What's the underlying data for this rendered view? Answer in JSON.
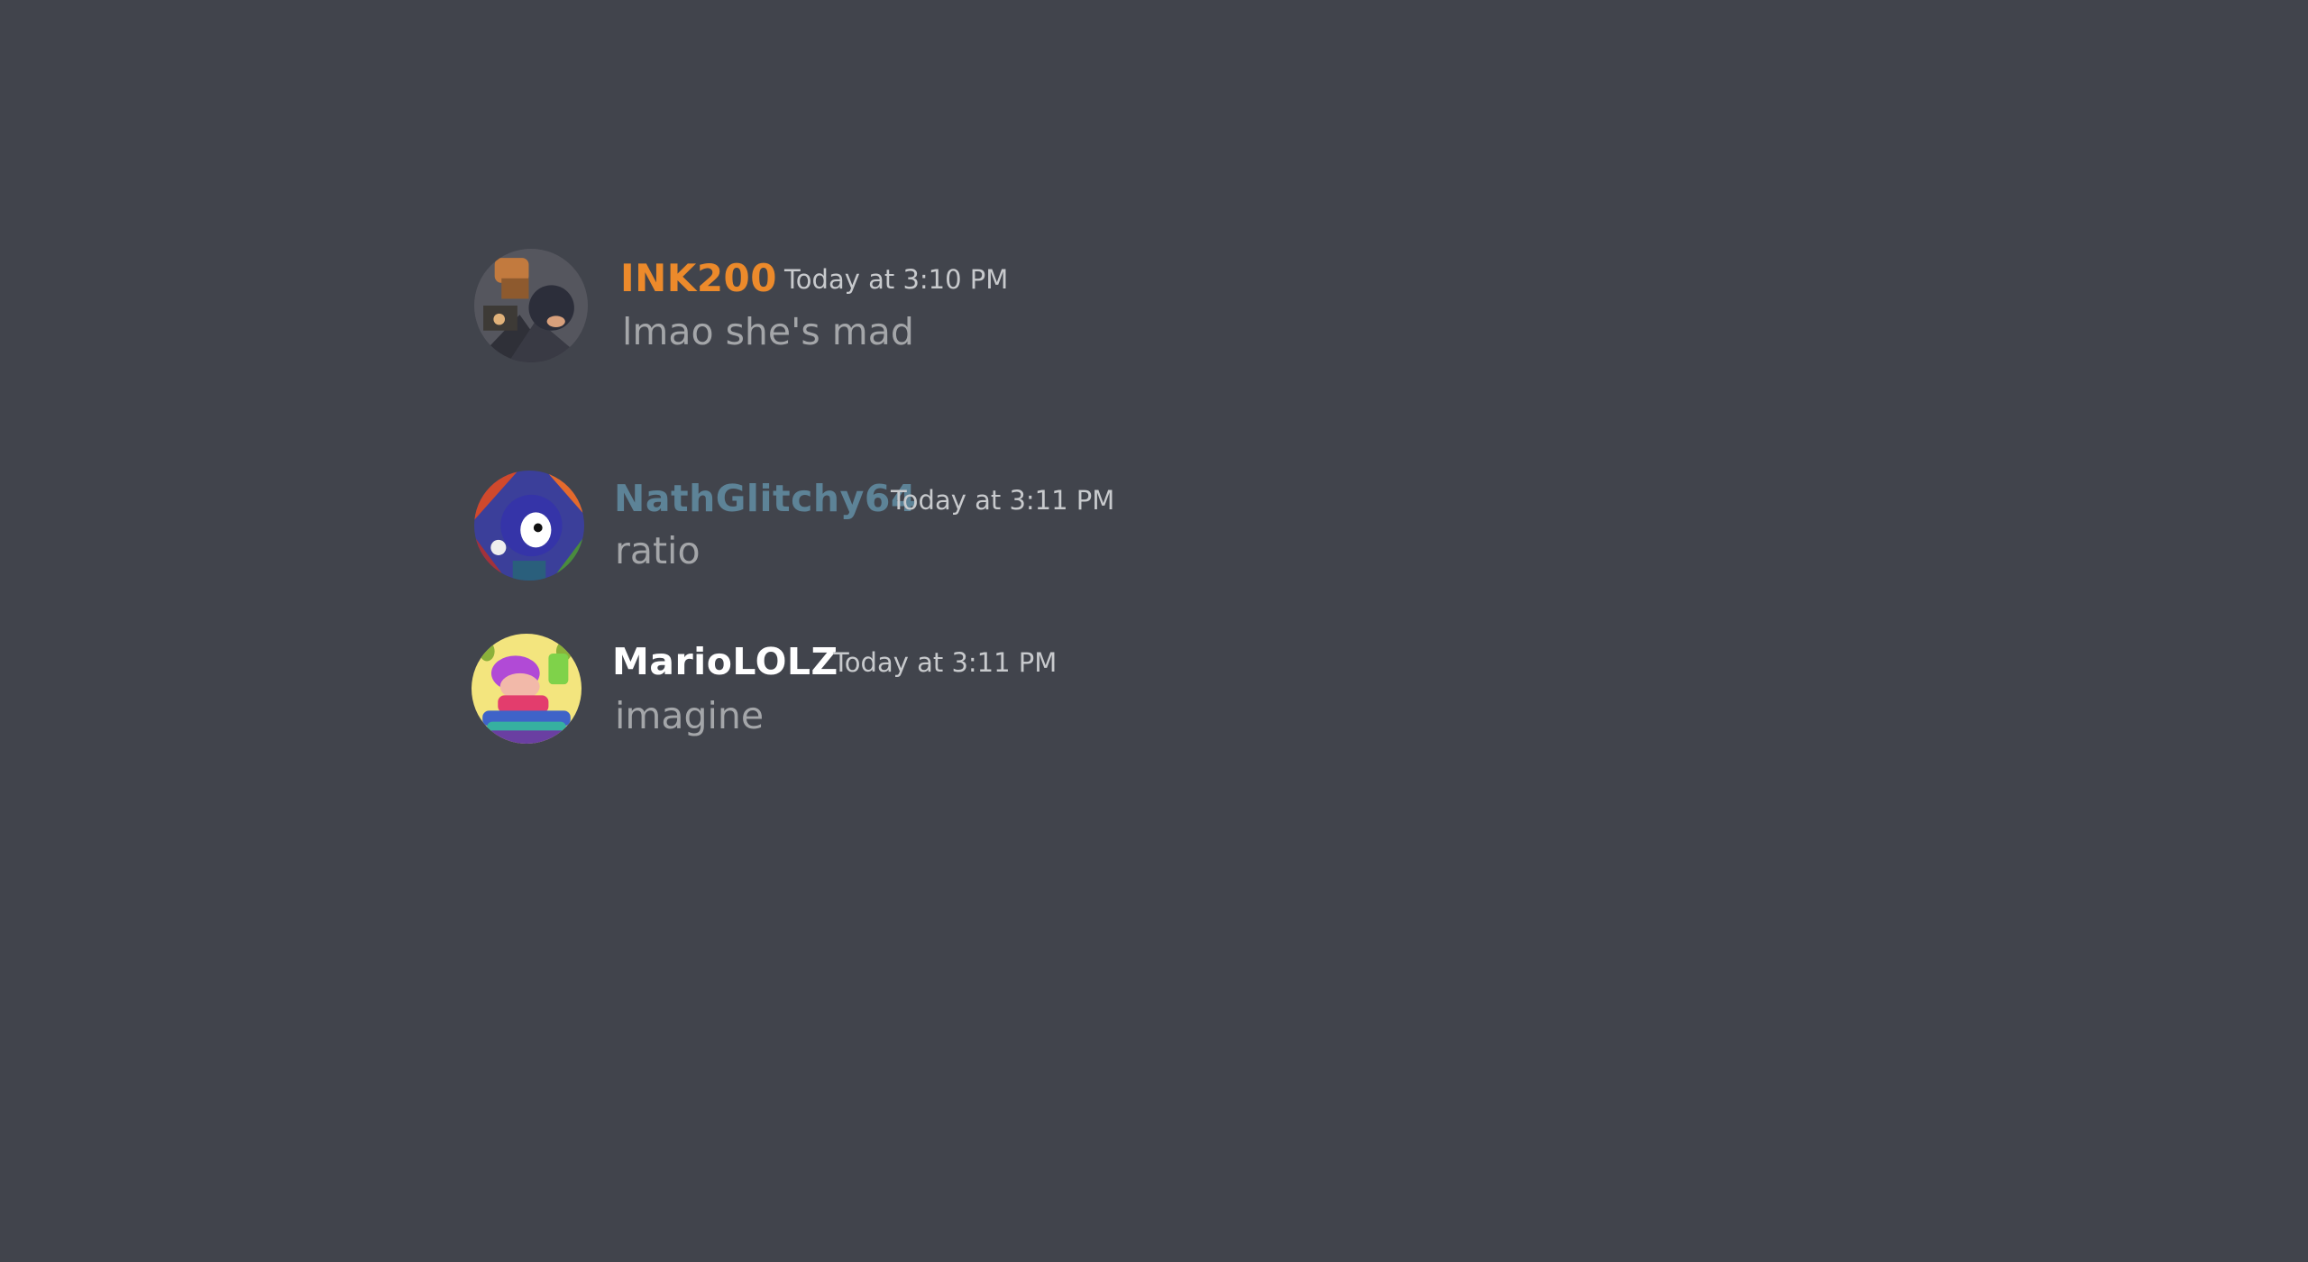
{
  "colors": {
    "background": "#41444c",
    "timestamp": "#c8cacd",
    "message_text": "#a4a6a9"
  },
  "messages": [
    {
      "username": "INK200",
      "username_color": "#ec8a2b",
      "timestamp": "Today at 3:10 PM",
      "text": "lmao she's mad",
      "avatar_icon": "ink200-avatar-icon"
    },
    {
      "username": "NathGlitchy64",
      "username_color": "#5d8397",
      "timestamp": "Today at 3:11 PM",
      "text": "ratio",
      "avatar_icon": "nathglitchy64-avatar-icon"
    },
    {
      "username": "MarioLOLZ",
      "username_color": "#ffffff",
      "timestamp": "Today at 3:11 PM",
      "text": "imagine",
      "avatar_icon": "mariololz-avatar-icon"
    }
  ]
}
